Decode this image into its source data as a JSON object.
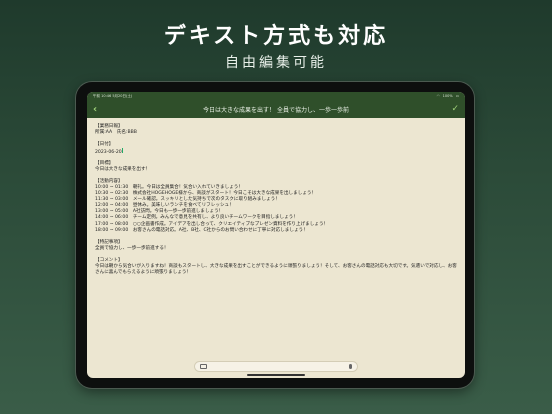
{
  "promo": {
    "headline": "デキスト方式も対応",
    "subline": "自由編集可能"
  },
  "statusbar": {
    "time": "午前 10:46",
    "date": "5月20日(土)",
    "battery": "100%"
  },
  "navbar": {
    "title": "今日は大きな成果を出す！ 全員で協力し、一歩一歩前"
  },
  "document": {
    "lines": [
      "【業務日報】",
      "所属:AA　氏名:BBB",
      "",
      "【日付】",
      "2023-06-20",
      "",
      "【目標】",
      "今日は大きな成果を出す！",
      "",
      "【活動内容】",
      "10:00 ~ 01:30　朝礼。今日は全員集合！気合い入れていきましょう！",
      "10:30 ~ 02:30　株式会社HOGEHOGE様から、商談がスタート！今日こそは大きな成果を出しましょう！",
      "11:30 ~ 03:00　メール確認。スッキリとした気持ちで次のタスクに取り組みましょう！",
      "12:00 ~ 04:00　昼休み。美味しいランチを食べてリフレッシュ！",
      "13:00 ~ 05:00　A社訪問。今日も一歩一歩前進しましょう！",
      "14:00 ~ 06:00　チーム定例。みんなで意見を共有し、より良いチームワークを目指しましょう！",
      "17:00 ~ 08:00　○○企画書作成。アイデアを出し合って、クリエイティブなプレゼン資料を作り上げましょう！",
      "18:00 ~ 09:00　お客さんの電話対応。A社、B社、C社からのお問い合わせに丁寧に対応しましょう！",
      "",
      "【特記事項】",
      "全員で協力し、一歩一歩前進する！",
      "",
      "【コメント】",
      "今日は朝から気合いが入りますね！商談もスタートし、大きな成果を出すことができるように頑張りましょう！そして、お客さんの電話対応も大切です。気遣いで対応し、お客",
      "さんに喜んでもらえるように頑張りましょう！"
    ]
  }
}
